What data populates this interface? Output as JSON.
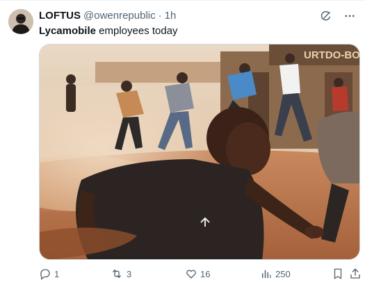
{
  "author": {
    "display_name": "LOFTUS",
    "handle": "@owenrepublic",
    "separator": "·",
    "time": "1h"
  },
  "tweet": {
    "bold_text": "Lycamobile",
    "rest_text": " employees today"
  },
  "media": {
    "sign_text": "URTDO-BO"
  },
  "actions": {
    "replies": "1",
    "retweets": "3",
    "likes": "16",
    "views": "250"
  },
  "colors": {
    "text": "#0f1419",
    "secondary": "#536471",
    "border": "#cfd9de"
  },
  "icons": {
    "grok": "grok-icon",
    "more": "more-icon",
    "reply": "reply-icon",
    "retweet": "retweet-icon",
    "like": "heart-icon",
    "views": "views-icon",
    "bookmark": "bookmark-icon",
    "share": "share-icon"
  }
}
